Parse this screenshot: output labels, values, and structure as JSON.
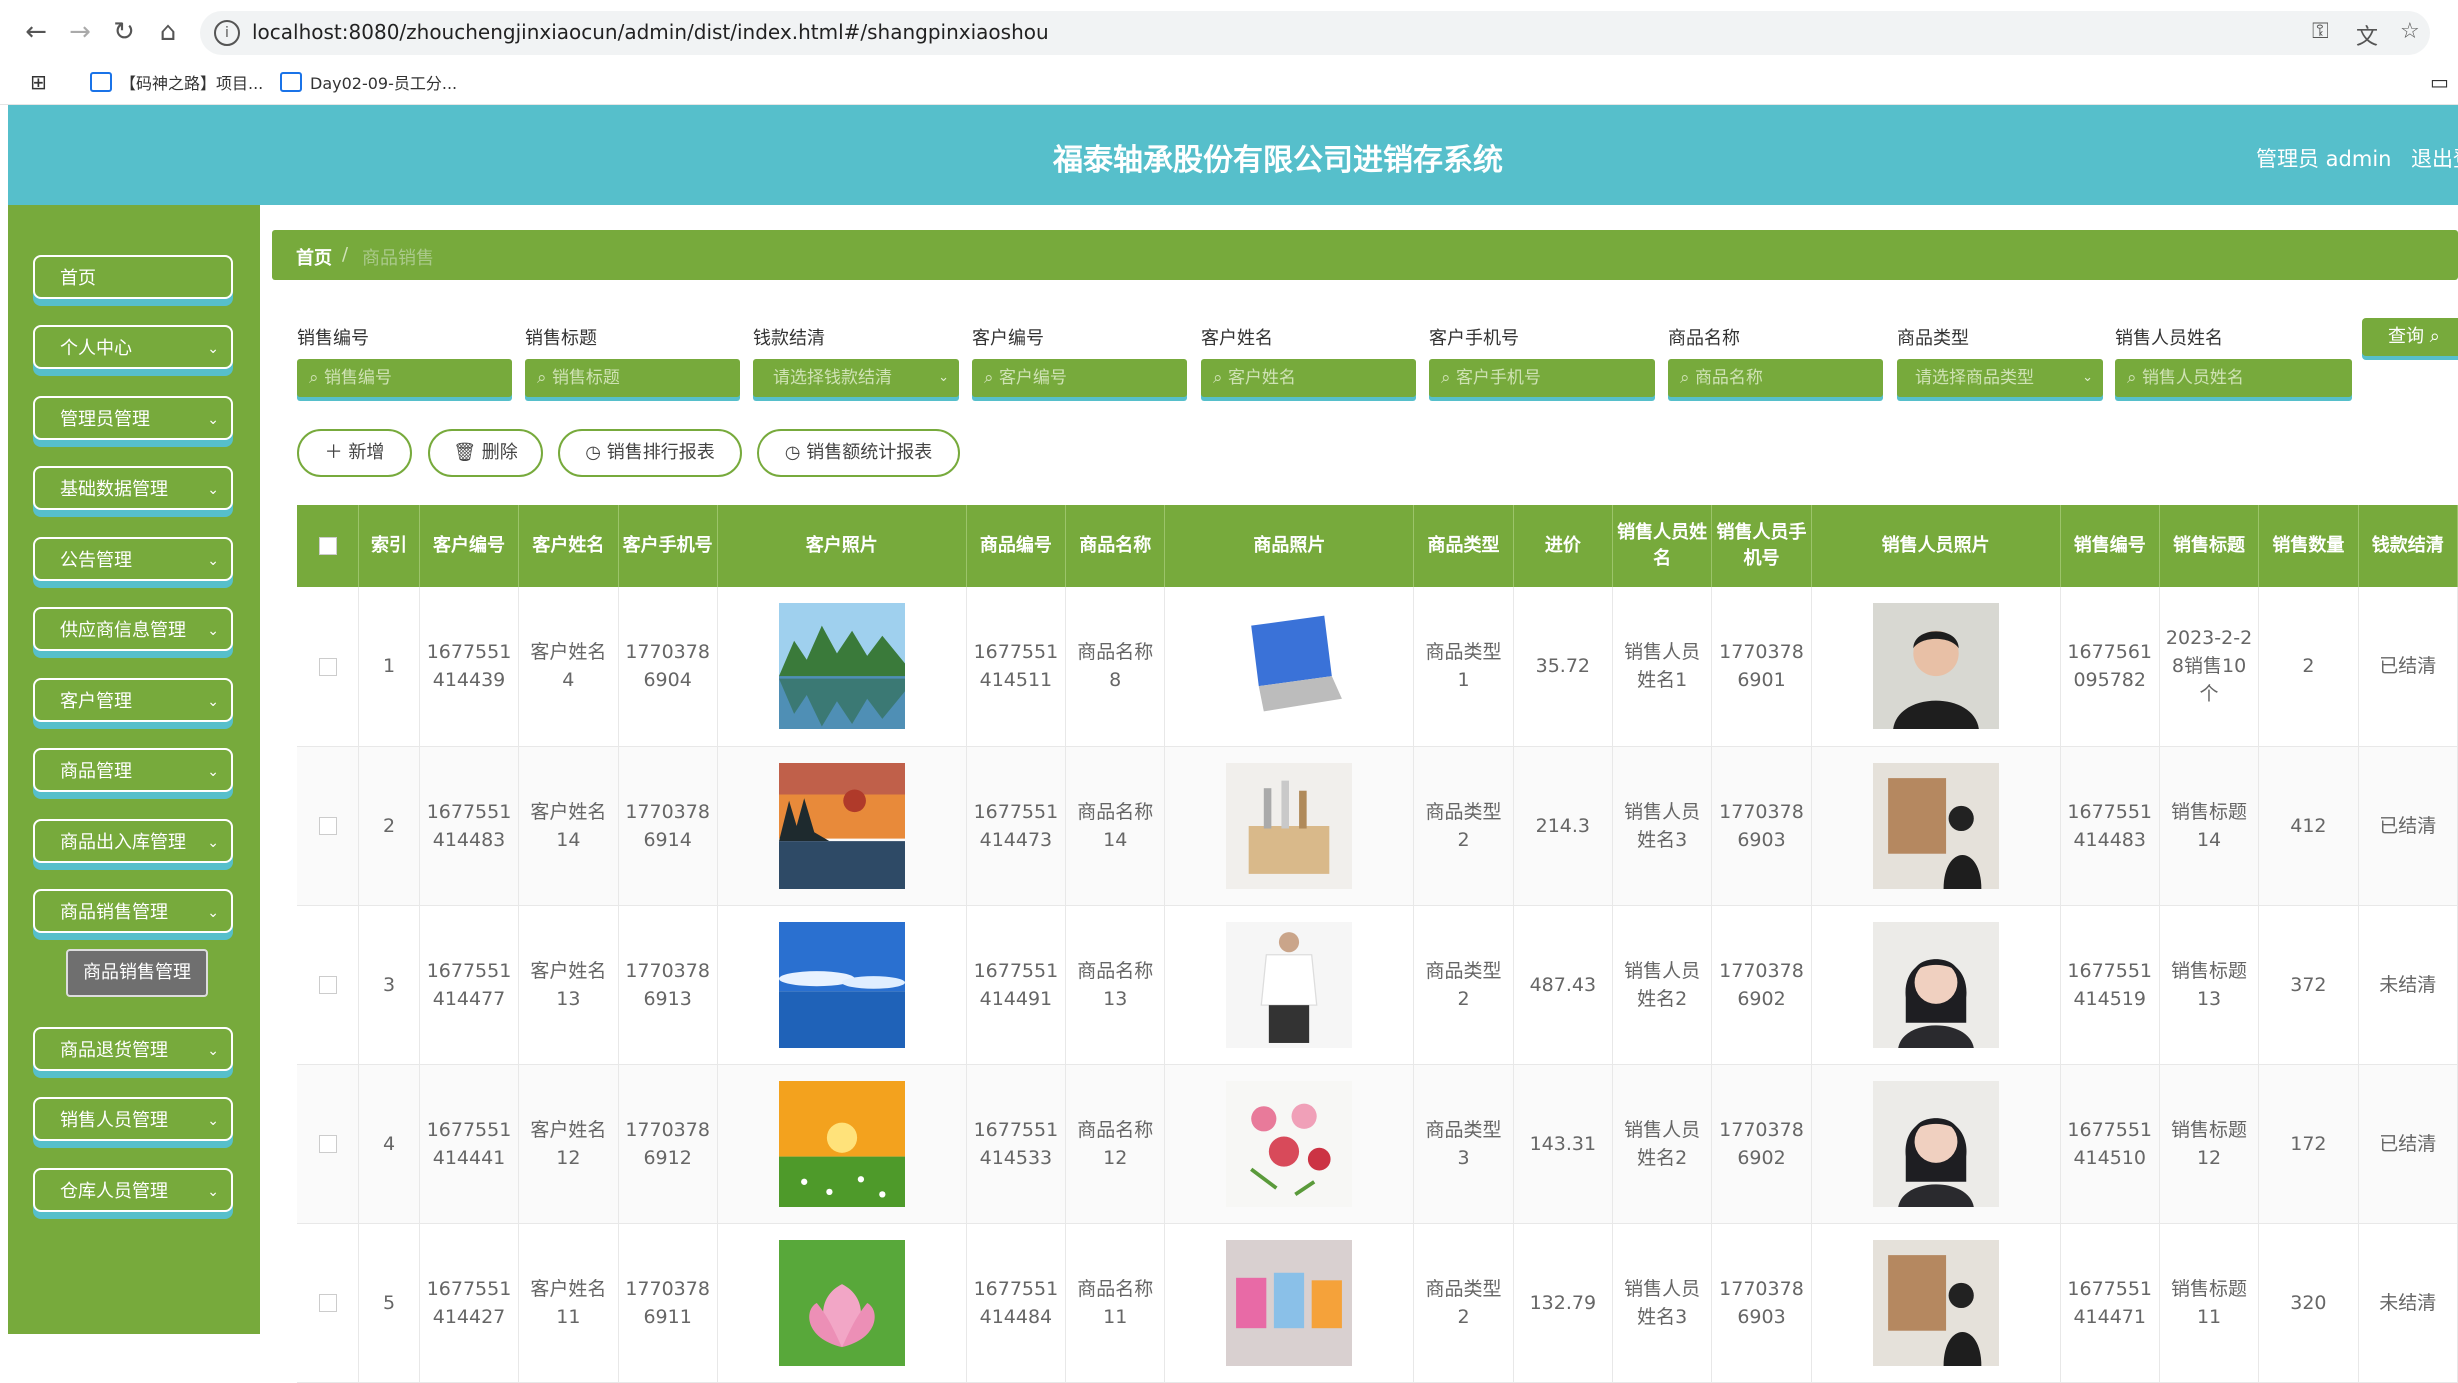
{
  "browser": {
    "url": "localhost:8080/zhouchengjinxiaocun/admin/dist/index.html#/shangpinxiaoshou",
    "bookmarks": [
      "【码神之路】项目...",
      "Day02-09-员工分..."
    ]
  },
  "header": {
    "title": "福泰轴承股份有限公司进销存系统",
    "user": "管理员 admin",
    "logout": "退出登"
  },
  "sidebar": {
    "items": [
      {
        "label": "首页",
        "has_chevron": false
      },
      {
        "label": "个人中心",
        "has_chevron": true
      },
      {
        "label": "管理员管理",
        "has_chevron": true
      },
      {
        "label": "基础数据管理",
        "has_chevron": true
      },
      {
        "label": "公告管理",
        "has_chevron": true
      },
      {
        "label": "供应商信息管理",
        "has_chevron": true
      },
      {
        "label": "客户管理",
        "has_chevron": true
      },
      {
        "label": "商品管理",
        "has_chevron": true
      },
      {
        "label": "商品出入库管理",
        "has_chevron": true
      },
      {
        "label": "商品销售管理",
        "has_chevron": true
      },
      {
        "label": "商品退货管理",
        "has_chevron": true
      },
      {
        "label": "销售人员管理",
        "has_chevron": true
      },
      {
        "label": "仓库人员管理",
        "has_chevron": true
      }
    ],
    "submenu": "商品销售管理"
  },
  "breadcrumb": {
    "home": "首页",
    "separator": "/",
    "current": "商品销售"
  },
  "filters": [
    {
      "label": "销售编号",
      "placeholder": "销售编号",
      "type": "input"
    },
    {
      "label": "销售标题",
      "placeholder": "销售标题",
      "type": "input"
    },
    {
      "label": "钱款结清",
      "placeholder": "请选择钱款结清",
      "type": "select"
    },
    {
      "label": "客户编号",
      "placeholder": "客户编号",
      "type": "input"
    },
    {
      "label": "客户姓名",
      "placeholder": "客户姓名",
      "type": "input"
    },
    {
      "label": "客户手机号",
      "placeholder": "客户手机号",
      "type": "input"
    },
    {
      "label": "商品名称",
      "placeholder": "商品名称",
      "type": "input"
    },
    {
      "label": "商品类型",
      "placeholder": "请选择商品类型",
      "type": "select"
    },
    {
      "label": "销售人员姓名",
      "placeholder": "销售人员姓名",
      "type": "input"
    }
  ],
  "query_button": "查询",
  "actions": {
    "add": "新增",
    "delete": "删除",
    "rank_report": "销售排行报表",
    "amount_report": "销售额统计报表"
  },
  "table": {
    "columns": [
      "索引",
      "客户编号",
      "客户姓名",
      "客户手机号",
      "客户照片",
      "商品编号",
      "商品名称",
      "商品照片",
      "商品类型",
      "进价",
      "销售人员姓名",
      "销售人员手机号",
      "销售人员照片",
      "销售编号",
      "销售标题",
      "销售数量",
      "钱款结清"
    ],
    "rows": [
      {
        "index": "1",
        "cust_no": "1677551414439",
        "cust_name": "客户姓名4",
        "cust_phone": "17703786904",
        "cust_photo": "mountain-lake",
        "goods_no": "1677551414511",
        "goods_name": "商品名称8",
        "goods_photo": "laptop",
        "goods_type": "商品类型1",
        "price": "35.72",
        "seller_name": "销售人员姓名1",
        "seller_phone": "17703786901",
        "seller_photo": "man-portrait",
        "sale_no": "1677561095782",
        "sale_title": "2023-2-28销售10个",
        "qty": "2",
        "settled": "已结清"
      },
      {
        "index": "2",
        "cust_no": "1677551414483",
        "cust_name": "客户姓名14",
        "cust_phone": "17703786914",
        "cust_photo": "sunset-lake",
        "goods_no": "1677551414473",
        "goods_name": "商品名称14",
        "goods_photo": "kitchen-box",
        "goods_type": "商品类型2",
        "price": "214.3",
        "seller_name": "销售人员姓名3",
        "seller_phone": "17703786903",
        "seller_photo": "painting-viewer",
        "sale_no": "1677551414483",
        "sale_title": "销售标题14",
        "qty": "412",
        "settled": "已结清"
      },
      {
        "index": "3",
        "cust_no": "1677551414477",
        "cust_name": "客户姓名13",
        "cust_phone": "17703786913",
        "cust_photo": "sky-sea",
        "goods_no": "1677551414491",
        "goods_name": "商品名称13",
        "goods_photo": "white-shirt",
        "goods_type": "商品类型2",
        "price": "487.43",
        "seller_name": "销售人员姓名2",
        "seller_phone": "17703786902",
        "seller_photo": "girl-portrait",
        "sale_no": "1677551414519",
        "sale_title": "销售标题13",
        "qty": "372",
        "settled": "未结清"
      },
      {
        "index": "4",
        "cust_no": "1677551414441",
        "cust_name": "客户姓名12",
        "cust_phone": "17703786912",
        "cust_photo": "sunrise-field",
        "goods_no": "1677551414533",
        "goods_name": "商品名称12",
        "goods_photo": "flowers",
        "goods_type": "商品类型3",
        "price": "143.31",
        "seller_name": "销售人员姓名2",
        "seller_phone": "17703786902",
        "seller_photo": "girl-portrait",
        "sale_no": "1677551414510",
        "sale_title": "销售标题12",
        "qty": "172",
        "settled": "已结清"
      },
      {
        "index": "5",
        "cust_no": "1677551414427",
        "cust_name": "客户姓名11",
        "cust_phone": "17703786911",
        "cust_photo": "lotus",
        "goods_no": "1677551414484",
        "goods_name": "商品名称11",
        "goods_photo": "colorful-bags",
        "goods_type": "商品类型2",
        "price": "132.79",
        "seller_name": "销售人员姓名3",
        "seller_phone": "17703786903",
        "seller_photo": "painting-viewer",
        "sale_no": "1677551414471",
        "sale_title": "销售标题11",
        "qty": "320",
        "settled": "未结清"
      }
    ]
  }
}
